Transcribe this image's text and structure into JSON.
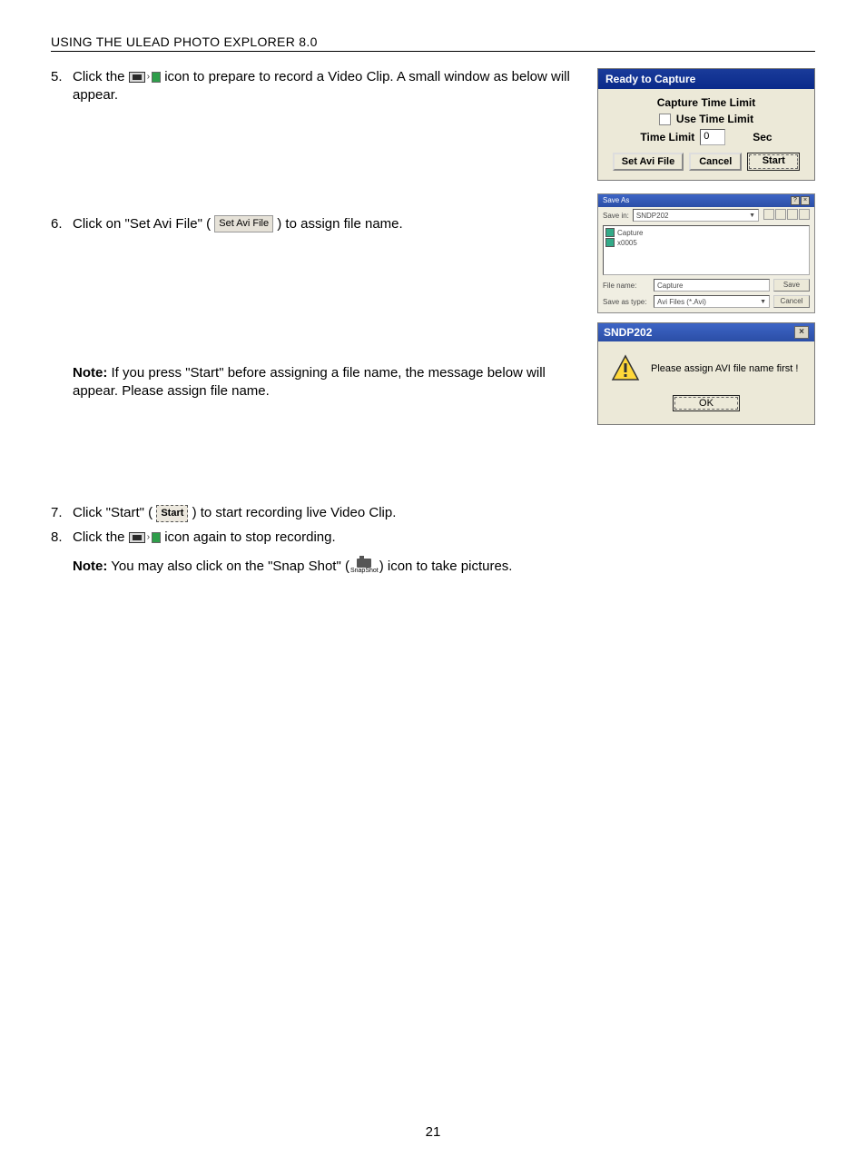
{
  "header": "USING THE ULEAD PHOTO EXPLORER 8.0",
  "steps": {
    "s5": {
      "num": "5.",
      "pre": "Click the ",
      "post": " icon to prepare to record a Video Clip. A small window as below will appear."
    },
    "s6": {
      "num": "6.",
      "pre": "Click on \"Set Avi File\" ( ",
      "post": " ) to assign file name."
    },
    "s7": {
      "num": "7.",
      "pre": "Click \"Start\" ( ",
      "post": " ) to start recording live Video Clip."
    },
    "s8": {
      "num": "8.",
      "pre": "Click the ",
      "post": " icon again to stop recording."
    }
  },
  "note1": {
    "label": "Note:",
    "text": " If you press \"Start\" before assigning a file name, the message below will appear. Please assign file name."
  },
  "note2": {
    "label": "Note:",
    "text_a": " You may also click on the \"Snap Shot\" (",
    "text_b": ") icon to take pictures."
  },
  "inline_buttons": {
    "set_avi": "Set Avi File",
    "start": "Start",
    "snapshot_label": "SnapShot"
  },
  "capture_dlg": {
    "title": "Ready to Capture",
    "group_label": "Capture Time Limit",
    "use_time_limit": "Use Time Limit",
    "time_limit_label": "Time Limit",
    "time_value": "0",
    "sec": "Sec",
    "btn_set": "Set Avi File",
    "btn_cancel": "Cancel",
    "btn_start": "Start"
  },
  "saveas_dlg": {
    "title": "Save As",
    "savein_label": "Save in:",
    "savein_value": "SNDP202",
    "files": [
      "Capture",
      "x0005"
    ],
    "filename_label": "File name:",
    "filename_value": "Capture",
    "type_label": "Save as type:",
    "type_value": "Avi Files (*.Avi)",
    "btn_save": "Save",
    "btn_cancel": "Cancel"
  },
  "alert_dlg": {
    "title": "SNDP202",
    "message": "Please assign AVI file name first !",
    "ok": "OK"
  },
  "page_number": "21"
}
